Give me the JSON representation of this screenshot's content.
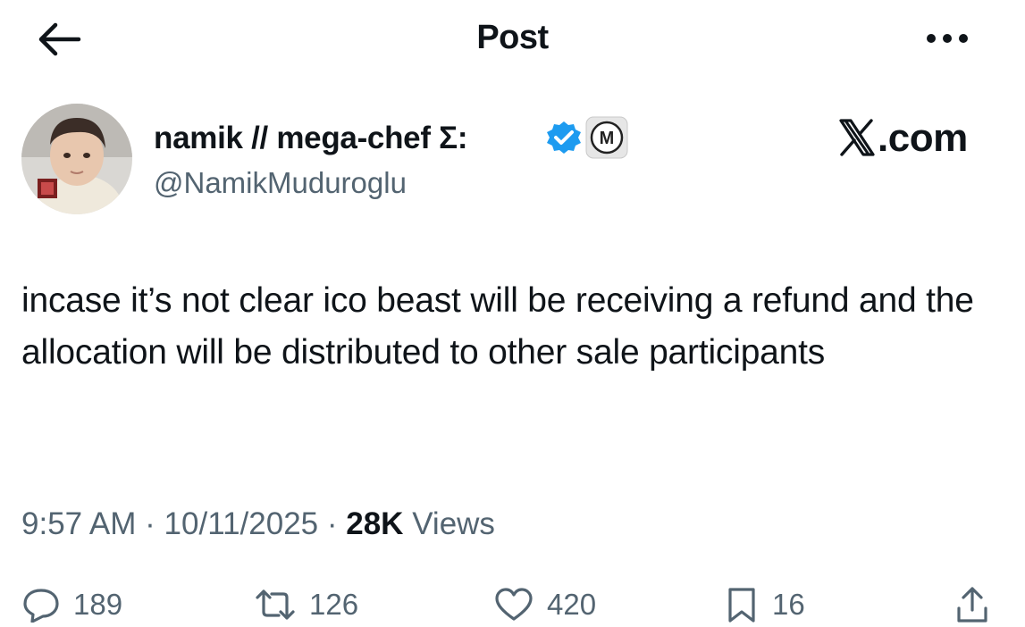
{
  "header": {
    "title": "Post",
    "back_icon": "arrow-left-icon",
    "more_icon": "more-horizontal-icon"
  },
  "author": {
    "display_name": "namik // mega-chef Σ:",
    "handle": "@NamikMuduroglu",
    "verified_icon": "verified-check-icon",
    "affiliate_badge_letter": "M"
  },
  "brand": {
    "logo_text": ".com"
  },
  "post": {
    "text": "incase it’s not clear ico beast will be receiving a refund and the allocation will be distributed to other sale participants",
    "time": "9:57 AM",
    "date": "10/11/2025",
    "sep": "·",
    "views_count": "28K",
    "views_label": "Views"
  },
  "actions": {
    "replies": "189",
    "reposts": "126",
    "likes": "420",
    "bookmarks": "16"
  },
  "colors": {
    "text": "#0f1419",
    "secondary": "#536471",
    "verified": "#1d9bf0"
  }
}
